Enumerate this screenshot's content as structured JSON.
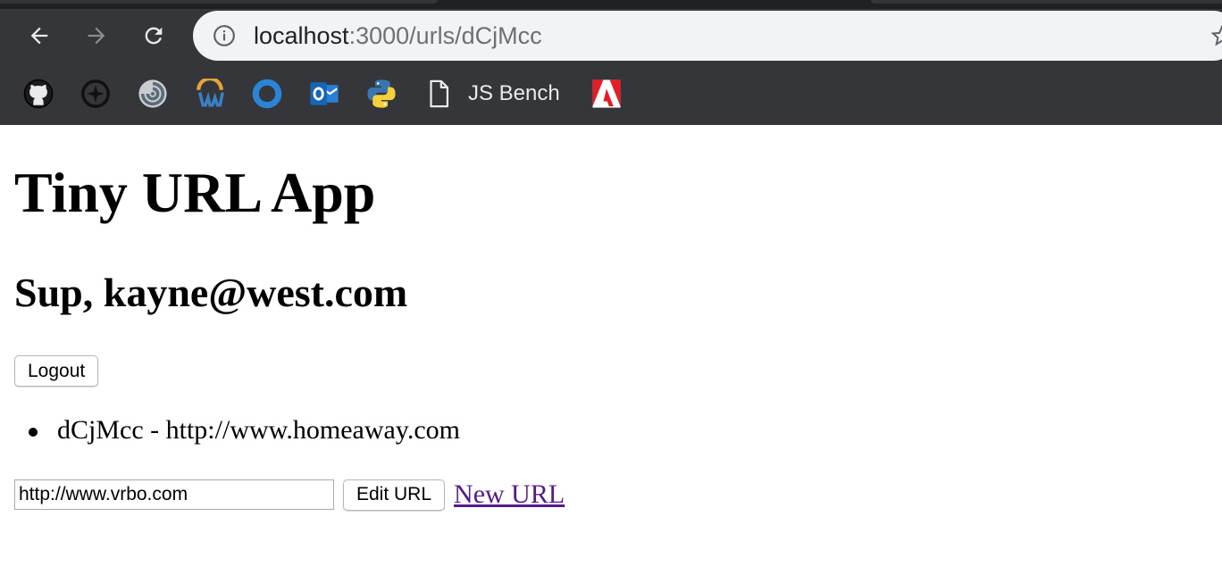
{
  "browser": {
    "address": {
      "host": "localhost",
      "rest": ":3000/urls/dCjMcc"
    },
    "bookmarks": [
      {
        "icon": "github-icon"
      },
      {
        "icon": "compass-icon"
      },
      {
        "icon": "swirl-icon"
      },
      {
        "icon": "w-logo-icon"
      },
      {
        "icon": "blue-ring-icon"
      },
      {
        "icon": "outlook-icon"
      },
      {
        "icon": "python-icon"
      },
      {
        "icon": "document-icon",
        "label": "JS Bench"
      },
      {
        "icon": "adobe-icon"
      }
    ]
  },
  "page": {
    "title": "Tiny URL App",
    "greeting": "Sup, kayne@west.com",
    "logout_label": "Logout",
    "urls": [
      {
        "text": "dCjMcc - http://www.homeaway.com"
      }
    ],
    "edit_form": {
      "input_value": "http://www.vrbo.com",
      "submit_label": "Edit URL"
    },
    "new_url_link": "New URL"
  },
  "colors": {
    "chrome_bg": "#35363a",
    "omnibox_bg": "#f1f3f4",
    "visited_link": "#551a8b"
  }
}
